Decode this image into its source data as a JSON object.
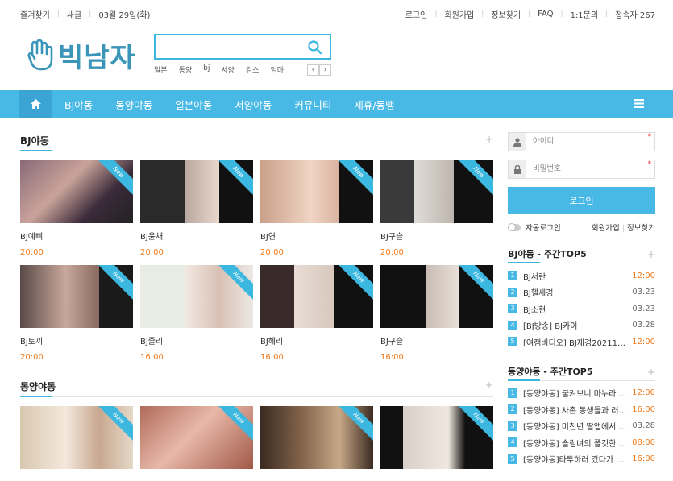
{
  "topbar": {
    "left": [
      "즐겨찾기",
      "새글",
      "03월 29일(화)"
    ],
    "right": [
      "로그인",
      "회원가입",
      "정보찾기",
      "FAQ",
      "1:1문의",
      "접속자 267"
    ]
  },
  "logo": {
    "text": "빅남자"
  },
  "search": {
    "value": ""
  },
  "quick_tags": [
    "일본",
    "동양",
    "bj",
    "서양",
    "검스",
    "엄마"
  ],
  "nav": {
    "items": [
      "BJ야동",
      "동양야동",
      "일본야동",
      "서양야동",
      "커뮤니티",
      "제휴/동맹"
    ]
  },
  "sections": [
    {
      "title": "BJ야동",
      "items": [
        {
          "title": "BJ예삐",
          "time": "20:00",
          "badge": "New"
        },
        {
          "title": "BJ윤채",
          "time": "20:00",
          "badge": "New"
        },
        {
          "title": "BJ연",
          "time": "20:00",
          "badge": "New"
        },
        {
          "title": "BJ구슬",
          "time": "20:00",
          "badge": "New"
        },
        {
          "title": "BJ토끼",
          "time": "20:00",
          "badge": "New"
        },
        {
          "title": "BJ졸리",
          "time": "16:00",
          "badge": "New"
        },
        {
          "title": "BJ혜리",
          "time": "16:00",
          "badge": "New"
        },
        {
          "title": "BJ구슬",
          "time": "16:00",
          "badge": "New"
        }
      ]
    },
    {
      "title": "동양야동",
      "items": [
        {
          "title": "",
          "time": "",
          "badge": "New"
        },
        {
          "title": "",
          "time": "",
          "badge": "New"
        },
        {
          "title": "",
          "time": "",
          "badge": "New"
        },
        {
          "title": "",
          "time": "",
          "badge": "New"
        }
      ]
    }
  ],
  "login": {
    "id_placeholder": "아이디",
    "pw_placeholder": "비밀번호",
    "button": "로그인",
    "auto": "자동로그인",
    "join": "회원가입",
    "find": "정보찾기"
  },
  "rank_bj": {
    "title": "BJ야동 - 주간TOP5",
    "items": [
      {
        "n": "1",
        "text": "BJ서란",
        "time": "12:00",
        "hot": true
      },
      {
        "n": "2",
        "text": "BJ헬세경",
        "time": "03.23",
        "hot": false
      },
      {
        "n": "3",
        "text": "BJ소현",
        "time": "03.23",
        "hot": false
      },
      {
        "n": "4",
        "text": "[BJ방송] BJ카이",
        "time": "03.28",
        "hot": false
      },
      {
        "n": "5",
        "text": "[여캠비디오] BJ재경20211…",
        "time": "12:00",
        "hot": true
      }
    ]
  },
  "rank_dong": {
    "title": "동양야동 - 주간TOP5",
    "items": [
      {
        "n": "1",
        "text": "[동양야동] 불켜보니 마누라 …",
        "time": "12:00",
        "hot": true
      },
      {
        "n": "2",
        "text": "[동양야동] 사촌 동생들과 러…",
        "time": "16:00",
        "hot": true
      },
      {
        "n": "3",
        "text": "[동양야동] 미친년 딸앱에서 …",
        "time": "03.28",
        "hot": false
      },
      {
        "n": "4",
        "text": "[동양야동] 슬림녀의 쫄깃한 …",
        "time": "08:00",
        "hot": true
      },
      {
        "n": "5",
        "text": "[동양야동]타투하러 갔다가 …",
        "time": "16:00",
        "hot": true
      }
    ]
  },
  "colors": {
    "accent": "#48b8e5",
    "time": "#f07a1a"
  }
}
